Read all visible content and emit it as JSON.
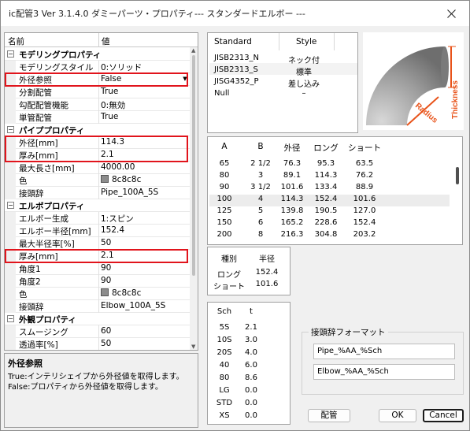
{
  "window": {
    "title": "ic配管3 Ver 3.1.4.0 ダミーパーツ・プロパティ--- スタンダードエルボー ---"
  },
  "grid": {
    "col_name": "名前",
    "col_value": "値",
    "rows": [
      {
        "type": "cat",
        "label": "モデリングプロパティ"
      },
      {
        "type": "prop",
        "label": "モデリングスタイル",
        "value": "0:ソリッド"
      },
      {
        "type": "prop",
        "label": "外径参照",
        "value": "False",
        "dropdown": true
      },
      {
        "type": "prop",
        "label": "分割配管",
        "value": "True"
      },
      {
        "type": "prop",
        "label": "勾配配管機能",
        "value": "0:無効"
      },
      {
        "type": "prop",
        "label": "単管配管",
        "value": "True"
      },
      {
        "type": "cat",
        "label": "パイププロパティ"
      },
      {
        "type": "prop",
        "label": "外径[mm]",
        "value": "114.3"
      },
      {
        "type": "prop",
        "label": "厚み[mm]",
        "value": "2.1"
      },
      {
        "type": "prop",
        "label": "最大長さ[mm]",
        "value": "4000.00"
      },
      {
        "type": "prop",
        "label": "色",
        "value": "8c8c8c",
        "swatch": true
      },
      {
        "type": "prop",
        "label": "接頭辞",
        "value": "Pipe_100A_5S"
      },
      {
        "type": "cat",
        "label": "エルボプロパティ"
      },
      {
        "type": "prop",
        "label": "エルボー生成",
        "value": "1:スピン"
      },
      {
        "type": "prop",
        "label": "エルボー半径[mm]",
        "value": "152.4"
      },
      {
        "type": "prop",
        "label": "最大半径率[%]",
        "value": "50"
      },
      {
        "type": "prop",
        "label": "厚み[mm]",
        "value": "2.1"
      },
      {
        "type": "prop",
        "label": "角度1",
        "value": "90"
      },
      {
        "type": "prop",
        "label": "角度2",
        "value": "90"
      },
      {
        "type": "prop",
        "label": "色",
        "value": "8c8c8c",
        "swatch": true
      },
      {
        "type": "prop",
        "label": "接頭辞",
        "value": "Elbow_100A_5S"
      },
      {
        "type": "cat",
        "label": "外観プロパティ"
      },
      {
        "type": "prop",
        "label": "スムージング",
        "value": "60"
      },
      {
        "type": "prop",
        "label": "透過率[%]",
        "value": "50"
      }
    ],
    "swatch_color": "#8c8c8c",
    "highlight_color": "#e1141c"
  },
  "description": {
    "title": "外径参照",
    "line1": "True:インテリシェイプから外径値を取得します。",
    "line2": "False:プロパティから外径値を取得します。"
  },
  "standards": {
    "col_standard": "Standard",
    "col_style": "Style",
    "rows": [
      {
        "name": "JISB2313_N",
        "style": "ネック付"
      },
      {
        "name": "JISB2313_S",
        "style": "標準"
      },
      {
        "name": "JISG4352_P",
        "style": "差し込み"
      },
      {
        "name": "Null",
        "style": "–"
      }
    ]
  },
  "diagram": {
    "label_radius": "Radius",
    "label_thickness": "Thickness"
  },
  "sizes": {
    "headers": [
      "A",
      "B",
      "外径",
      "ロング",
      "ショート"
    ],
    "rows": [
      [
        "65",
        "2 1/2",
        "76.3",
        "95.3",
        "63.5"
      ],
      [
        "80",
        "3",
        "89.1",
        "114.3",
        "76.2"
      ],
      [
        "90",
        "3 1/2",
        "101.6",
        "133.4",
        "88.9"
      ],
      [
        "100",
        "4",
        "114.3",
        "152.4",
        "101.6"
      ],
      [
        "125",
        "5",
        "139.8",
        "190.5",
        "127.0"
      ],
      [
        "150",
        "6",
        "165.2",
        "228.6",
        "152.4"
      ],
      [
        "200",
        "8",
        "216.3",
        "304.8",
        "203.2"
      ]
    ]
  },
  "radius": {
    "headers": [
      "種別",
      "半径"
    ],
    "rows": [
      [
        "ロング",
        "152.4"
      ],
      [
        "ショート",
        "101.6"
      ]
    ]
  },
  "schedule": {
    "headers": [
      "Sch",
      "t"
    ],
    "rows": [
      [
        "5S",
        "2.1"
      ],
      [
        "10S",
        "3.0"
      ],
      [
        "20S",
        "4.0"
      ],
      [
        "40",
        "6.0"
      ],
      [
        "80",
        "8.6"
      ],
      [
        "LG",
        "0.0"
      ],
      [
        "STD",
        "0.0"
      ],
      [
        "XS",
        "0.0"
      ]
    ]
  },
  "prefix_format": {
    "label": "接頭辞フォーマット",
    "pipe": "Pipe_%AA_%Sch",
    "elbow": "Elbow_%AA_%Sch"
  },
  "buttons": {
    "piping": "配管",
    "ok": "OK",
    "cancel": "Cancel"
  }
}
